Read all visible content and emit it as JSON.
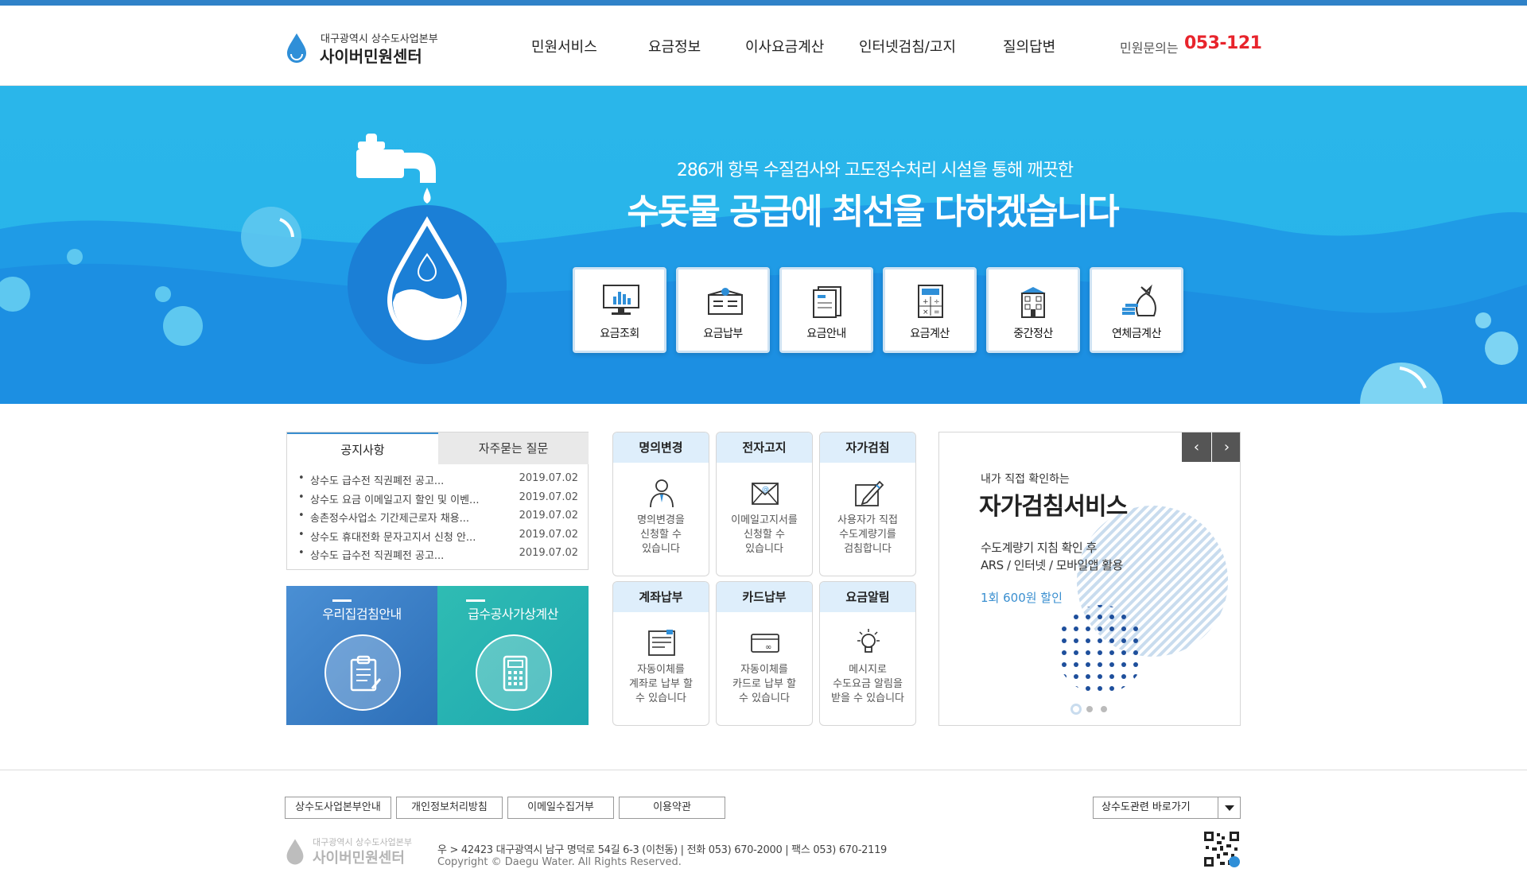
{
  "header": {
    "logo_sub": "대구광역시 상수도사업본부",
    "logo_main": "사이버민원센터",
    "nav": [
      "민원서비스",
      "요금정보",
      "이사요금계산",
      "인터넷검침/고지",
      "질의답변"
    ],
    "contact_label": "민원문의는",
    "contact_number": "053-121"
  },
  "hero": {
    "subtitle": "286개 항목 수질검사와 고도정수처리 시설을 통해 깨끗한",
    "title": "수돗물 공급에 최선을 다하겠습니다",
    "services": [
      {
        "label": "요금조회",
        "icon": "monitor-chart-icon"
      },
      {
        "label": "요금납부",
        "icon": "wallet-icon"
      },
      {
        "label": "요금안내",
        "icon": "document-icon"
      },
      {
        "label": "요금계산",
        "icon": "calculator-icon"
      },
      {
        "label": "중간정산",
        "icon": "building-icon"
      },
      {
        "label": "연체금계산",
        "icon": "money-bag-icon"
      }
    ]
  },
  "notice": {
    "tab_active": "공지사항",
    "tab_inactive": "자주묻는 질문",
    "items": [
      {
        "title": "상수도 급수전 직권폐전 공고...",
        "date": "2019.07.02"
      },
      {
        "title": "상수도 요금 이메일고지 할인 및 이벤...",
        "date": "2019.07.02"
      },
      {
        "title": "송촌정수사업소 기간제근로자 채용...",
        "date": "2019.07.02"
      },
      {
        "title": "상수도 휴대전화 문자고지서 신청 안...",
        "date": "2019.07.02"
      },
      {
        "title": "상수도 급수전 직권폐전 공고...",
        "date": "2019.07.02"
      }
    ]
  },
  "banners": {
    "left": "우리집검침안내",
    "right": "급수공사가상계산"
  },
  "cards": [
    {
      "title": "명의변경",
      "desc": [
        "명의변경을",
        "신청할 수",
        "있습니다"
      ],
      "icon": "person-icon"
    },
    {
      "title": "전자고지",
      "desc": [
        "이메일고지서를",
        "신청할 수",
        "있습니다"
      ],
      "icon": "email-icon"
    },
    {
      "title": "자가검침",
      "desc": [
        "사용자가 직접",
        "수도계량기를",
        "검침합니다"
      ],
      "icon": "pen-edit-icon"
    },
    {
      "title": "계좌납부",
      "desc": [
        "자동이체를",
        "계좌로 납부 할",
        "수 있습니다"
      ],
      "icon": "bank-book-icon"
    },
    {
      "title": "카드납부",
      "desc": [
        "자동이체를",
        "카드로 납부 할",
        "수 있습니다"
      ],
      "icon": "card-icon"
    },
    {
      "title": "요금알림",
      "desc": [
        "메시지로",
        "수도요금 알림을",
        "받을 수 있습니다"
      ],
      "icon": "lightbulb-icon"
    }
  ],
  "promo": {
    "prev": "‹",
    "next": "›",
    "eyebrow": "내가 직접 확인하는",
    "title": "자가검침서비스",
    "line1": "수도계량기 지침 확인 후",
    "line2": "ARS / 인터넷 / 모바일앱 활용",
    "highlight": "1회 600원 할인",
    "slide_count": 3,
    "active_slide": 1
  },
  "footer": {
    "links": [
      "상수도사업본부안내",
      "개인정보처리방침",
      "이메일수집거부",
      "이용약관"
    ],
    "select_value": "상수도관련 바로가기",
    "logo_sub": "대구광역시 상수도사업본부",
    "logo_main": "사이버민원센터",
    "address": "우 > 42423 대구광역시 남구 명덕로 54길 6-3 (이천동) | 전화 053) 670-2000 | 팩스 053) 670-2119",
    "copyright": "Copyright © Daegu Water. All Rights Reserved."
  },
  "colors": {
    "accent": "#2f82c8",
    "hero_bg": "#29b5ea",
    "contact_red": "#e8242c",
    "card_head": "#deeefb",
    "banner_left": "#3a7fc9",
    "banner_right": "#23b3b0"
  }
}
